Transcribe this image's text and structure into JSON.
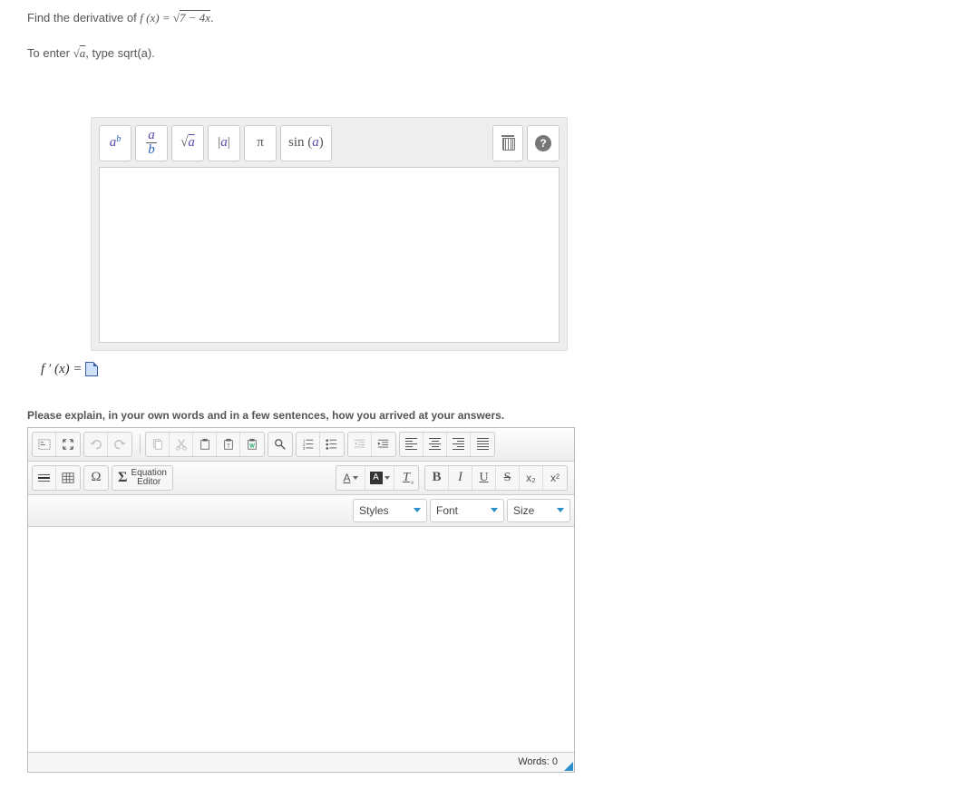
{
  "question": {
    "prefix": "Find the derivative of ",
    "func_lhs": "f (x) = ",
    "sqrt_radicand": "7 − 4x",
    "period": ".",
    "hint_prefix": "To enter ",
    "hint_sqrt_rad": "a",
    "hint_suffix": ", type sqrt(a)."
  },
  "eq_toolbar": {
    "exp_base": "a",
    "exp_sup": "b",
    "frac_top": "a",
    "frac_bot": "b",
    "sqrt_arg": "a",
    "abs_arg": "a",
    "pi": "π",
    "trig_prefix": "sin (",
    "trig_arg": "a",
    "trig_suffix": ")",
    "help": "?"
  },
  "answer": {
    "lhs": "f ′ (x) ="
  },
  "explain_prompt": "Please explain, in your own words and in a few sentences, how you arrived at your answers.",
  "rte": {
    "eq_editor_label": "Equation\nEditor",
    "styles_label": "Styles",
    "font_label": "Font",
    "size_label": "Size",
    "bold": "B",
    "italic": "I",
    "underline": "U",
    "strike": "S",
    "sub_base": "x",
    "sub_sub": "₂",
    "sup_base": "x",
    "sup_sup": "²",
    "textcolor_letter": "A",
    "bgcolor_letter": "A",
    "clearfmt_letter": "T",
    "omega": "Ω",
    "sigma": "Σ",
    "wordcount_label": "Words: 0"
  }
}
